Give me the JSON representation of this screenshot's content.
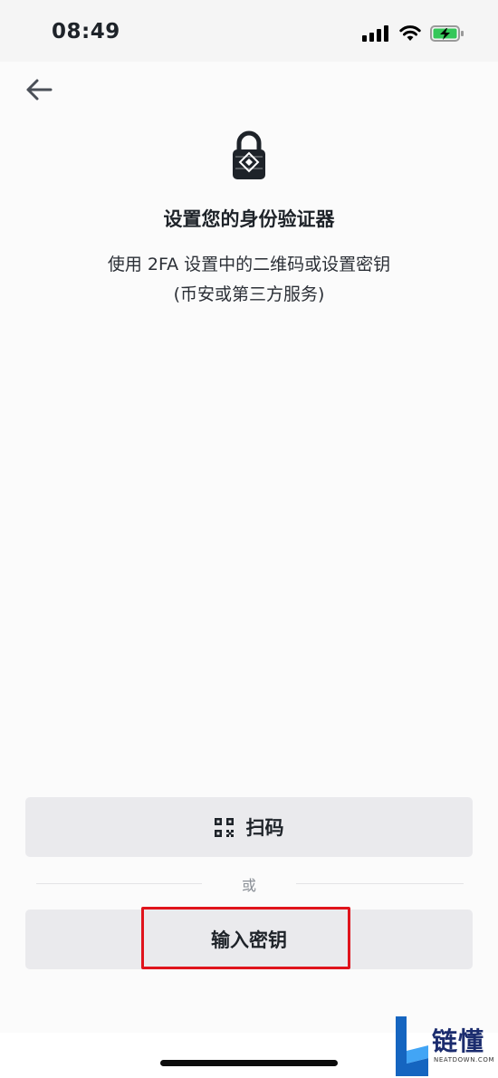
{
  "status_bar": {
    "time": "08:49"
  },
  "header": {
    "back_icon": "arrow-left-icon"
  },
  "hero": {
    "icon": "lock-icon",
    "title": "设置您的身份验证器",
    "subtitle_line1": "使用 2FA 设置中的二维码或设置密钥",
    "subtitle_line2": "(币安或第三方服务)"
  },
  "actions": {
    "scan_icon": "qr-code-icon",
    "scan_label": "扫码",
    "divider_label": "或",
    "enter_key_label": "输入密钥"
  },
  "watermark": {
    "brand": "链懂",
    "domain": "NEATDOWN.COM"
  },
  "colors": {
    "accent_highlight": "#e0141c",
    "button_bg": "#eaeaed",
    "text": "#1e2329",
    "watermark": "#1b2c6e"
  }
}
